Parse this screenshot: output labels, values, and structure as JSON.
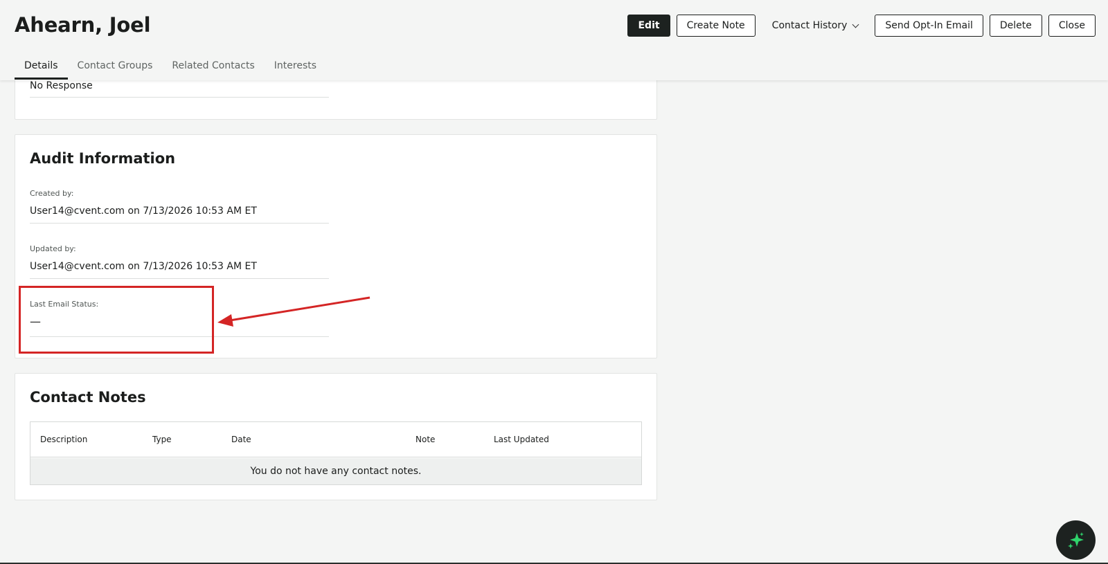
{
  "header": {
    "title": "Ahearn, Joel",
    "actions": {
      "edit": "Edit",
      "create_note": "Create Note",
      "contact_history": "Contact History",
      "send_opt_in": "Send Opt-In Email",
      "delete": "Delete",
      "close": "Close"
    }
  },
  "tabs": [
    {
      "label": "Details",
      "active": true
    },
    {
      "label": "Contact Groups"
    },
    {
      "label": "Related Contacts"
    },
    {
      "label": "Interests"
    }
  ],
  "top_card": {
    "value": "No Response"
  },
  "audit": {
    "title": "Audit Information",
    "created_label": "Created by:",
    "created_value": "User14@cvent.com on 7/13/2026 10:53 AM ET",
    "updated_label": "Updated by:",
    "updated_value": "User14@cvent.com on 7/13/2026 10:53 AM ET",
    "last_email_label": "Last Email Status:",
    "last_email_value": "—"
  },
  "notes": {
    "title": "Contact Notes",
    "columns": [
      "Description",
      "Type",
      "Date",
      "Note",
      "Last Updated"
    ],
    "empty_message": "You do not have any contact notes."
  },
  "icons": {
    "fab": "sparkle-icon",
    "contact_history": "chevron-down-icon"
  },
  "colors": {
    "annotation": "#d42525",
    "primary_button": "#1d2220",
    "fab_icon": "#2fd36b"
  }
}
